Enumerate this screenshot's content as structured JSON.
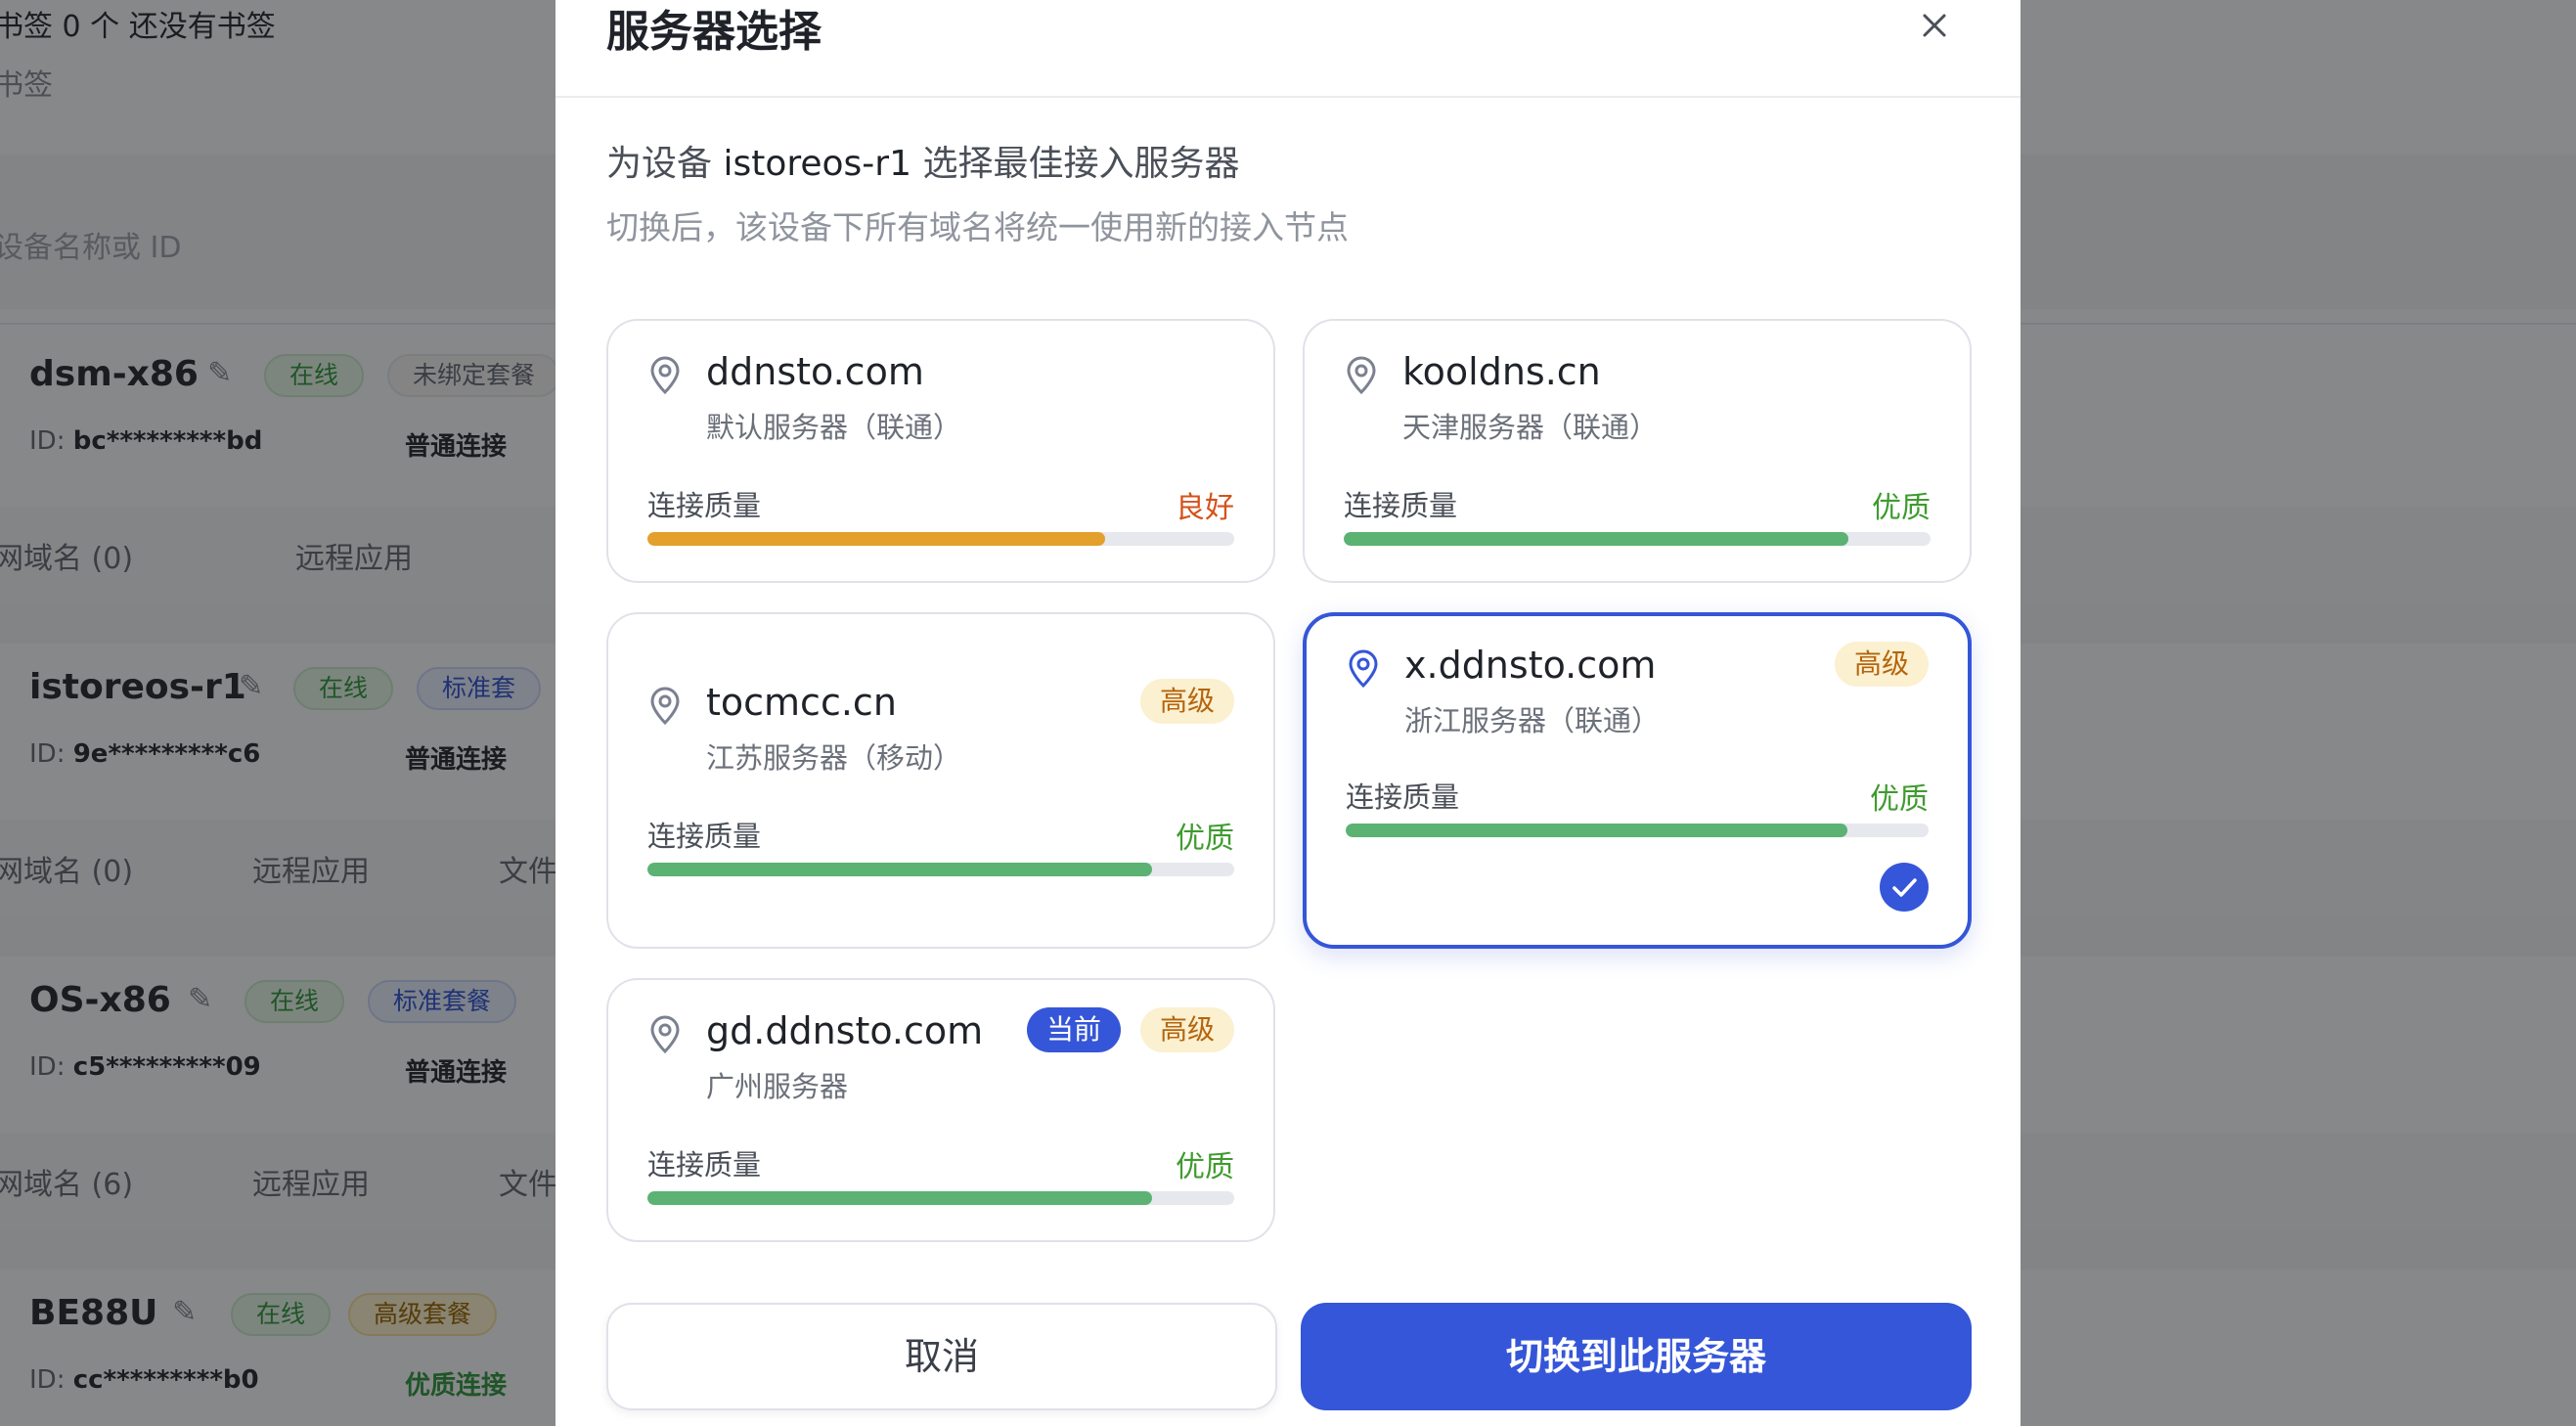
{
  "background": {
    "bookmarks_line": "书签  0 个  还没有书签",
    "bookmarks_sub": "书签",
    "search_placeholder": "设备名称或 ID",
    "devices": [
      {
        "name": "dsm-x86",
        "status": "在线",
        "plan": "未绑定套餐",
        "id_label": "ID:",
        "id": "bc*********bd",
        "conn": "普通连接",
        "domain_label": "网域名 (0)",
        "app_label": "远程应用",
        "file_label": ""
      },
      {
        "name": "istoreos-r1",
        "status": "在线",
        "plan": "标准套",
        "id_label": "ID:",
        "id": "9e*********c6",
        "conn": "普通连接",
        "domain_label": "网域名 (0)",
        "app_label": "远程应用",
        "file_label": "文件"
      },
      {
        "name": "OS-x86",
        "status": "在线",
        "plan": "标准套餐",
        "id_label": "ID:",
        "id": "c5*********09",
        "conn": "普通连接",
        "domain_label": "网域名 (6)",
        "app_label": "远程应用",
        "file_label": "文件"
      },
      {
        "name": "BE88U",
        "status": "在线",
        "plan": "高级套餐",
        "id_label": "ID:",
        "id": "cc*********b0",
        "conn": "优质连接",
        "domain_label": "",
        "app_label": "",
        "file_label": ""
      }
    ]
  },
  "modal": {
    "title": "服务器选择",
    "desc_prefix": "为设备 ",
    "device_name": "istoreos-r1",
    "desc_suffix": " 选择最佳接入服务器",
    "subdesc": "切换后，该设备下所有域名将统一使用新的接入节点",
    "quality_label": "连接质量",
    "servers": [
      {
        "host": "ddnsto.com",
        "location": "默认服务器（联通）",
        "quality": "良好",
        "quality_level": 0.78,
        "badges": [],
        "selected": false
      },
      {
        "host": "kooldns.cn",
        "location": "天津服务器（联通）",
        "quality": "优质",
        "quality_level": 0.86,
        "badges": [],
        "selected": false
      },
      {
        "host": "tocmcc.cn",
        "location": "江苏服务器（移动）",
        "quality": "优质",
        "quality_level": 0.86,
        "badges": [
          "高级"
        ],
        "selected": false
      },
      {
        "host": "x.ddnsto.com",
        "location": "浙江服务器（联通）",
        "quality": "优质",
        "quality_level": 0.86,
        "badges": [
          "高级"
        ],
        "selected": true
      },
      {
        "host": "gd.ddnsto.com",
        "location": "广州服务器",
        "quality": "优质",
        "quality_level": 0.86,
        "badges": [
          "当前",
          "高级"
        ],
        "selected": false
      }
    ],
    "cancel_label": "取消",
    "confirm_label": "切换到此服务器"
  },
  "colors": {
    "accent": "#3556d8",
    "quality_good": "#e3a02c",
    "quality_excellent": "#5bb273",
    "badge_adv_bg": "#fbf0cf"
  }
}
